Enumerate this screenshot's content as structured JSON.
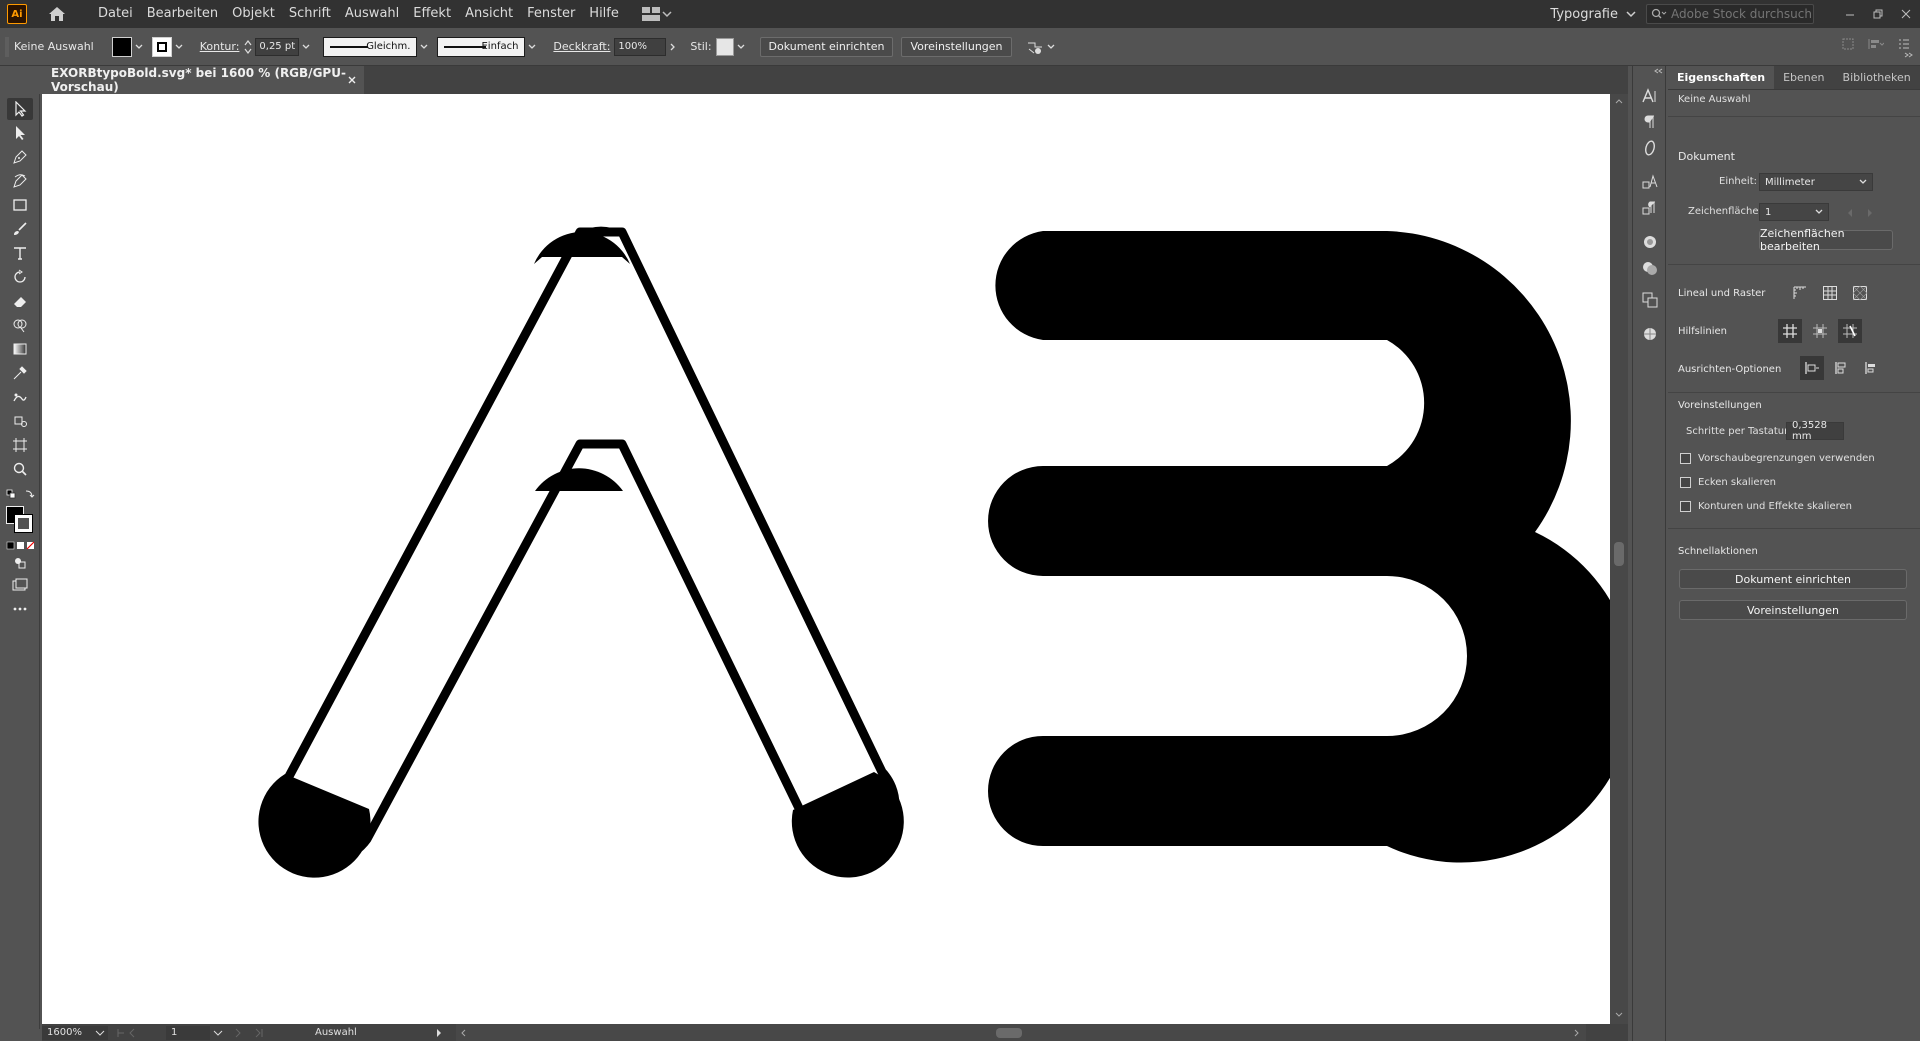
{
  "app": {
    "logo_text": "Ai",
    "menu": [
      "Datei",
      "Bearbeiten",
      "Objekt",
      "Schrift",
      "Auswahl",
      "Effekt",
      "Ansicht",
      "Fenster",
      "Hilfe"
    ],
    "workspace": "Typografie",
    "stock_search_placeholder": "Adobe Stock durchsuchen"
  },
  "control_bar": {
    "selection_status": "Keine Auswahl",
    "stroke_label": "Kontur:",
    "stroke_weight": "0,25 pt",
    "stroke_profile": "Gleichm.",
    "brush": "Einfach",
    "opacity_label": "Deckkraft:",
    "opacity_value": "100%",
    "style_label": "Stil:",
    "document_setup": "Dokument einrichten",
    "preferences": "Voreinstellungen"
  },
  "document": {
    "tab_title": "EXORBtypoBold.svg* bei 1600 % (RGB/GPU-Vorschau)",
    "artwork_glyphs": [
      "A",
      "B"
    ]
  },
  "status_bar": {
    "zoom": "1600%",
    "artboard": "1",
    "tool_status": "Auswahl"
  },
  "properties_panel": {
    "tabs": [
      "Eigenschaften",
      "Ebenen",
      "Bibliotheken"
    ],
    "selection": "Keine Auswahl",
    "document_title": "Dokument",
    "unit_label": "Einheit:",
    "unit_value": "Millimeter",
    "artboard_label": "Zeichenfläche:",
    "artboard_value": "1",
    "edit_artboards": "Zeichenflächen bearbeiten",
    "rulers_grids": "Lineal und Raster",
    "guides": "Hilfslinien",
    "align_options": "Ausrichten-Optionen",
    "preferences_title": "Voreinstellungen",
    "keyboard_increment_label": "Schritte per Tastatur:",
    "keyboard_increment_value": "0,3528 mm",
    "checkboxes": [
      "Vorschaubegrenzungen verwenden",
      "Ecken skalieren",
      "Konturen und Effekte skalieren"
    ],
    "quick_actions_title": "Schnellaktionen",
    "quick_actions": [
      "Dokument einrichten",
      "Voreinstellungen"
    ]
  },
  "colors": {
    "fill": "#000000",
    "stroke": "#ffffff",
    "app_accent": "#ff9a00",
    "chrome_dark": "#323232",
    "chrome": "#535353"
  }
}
